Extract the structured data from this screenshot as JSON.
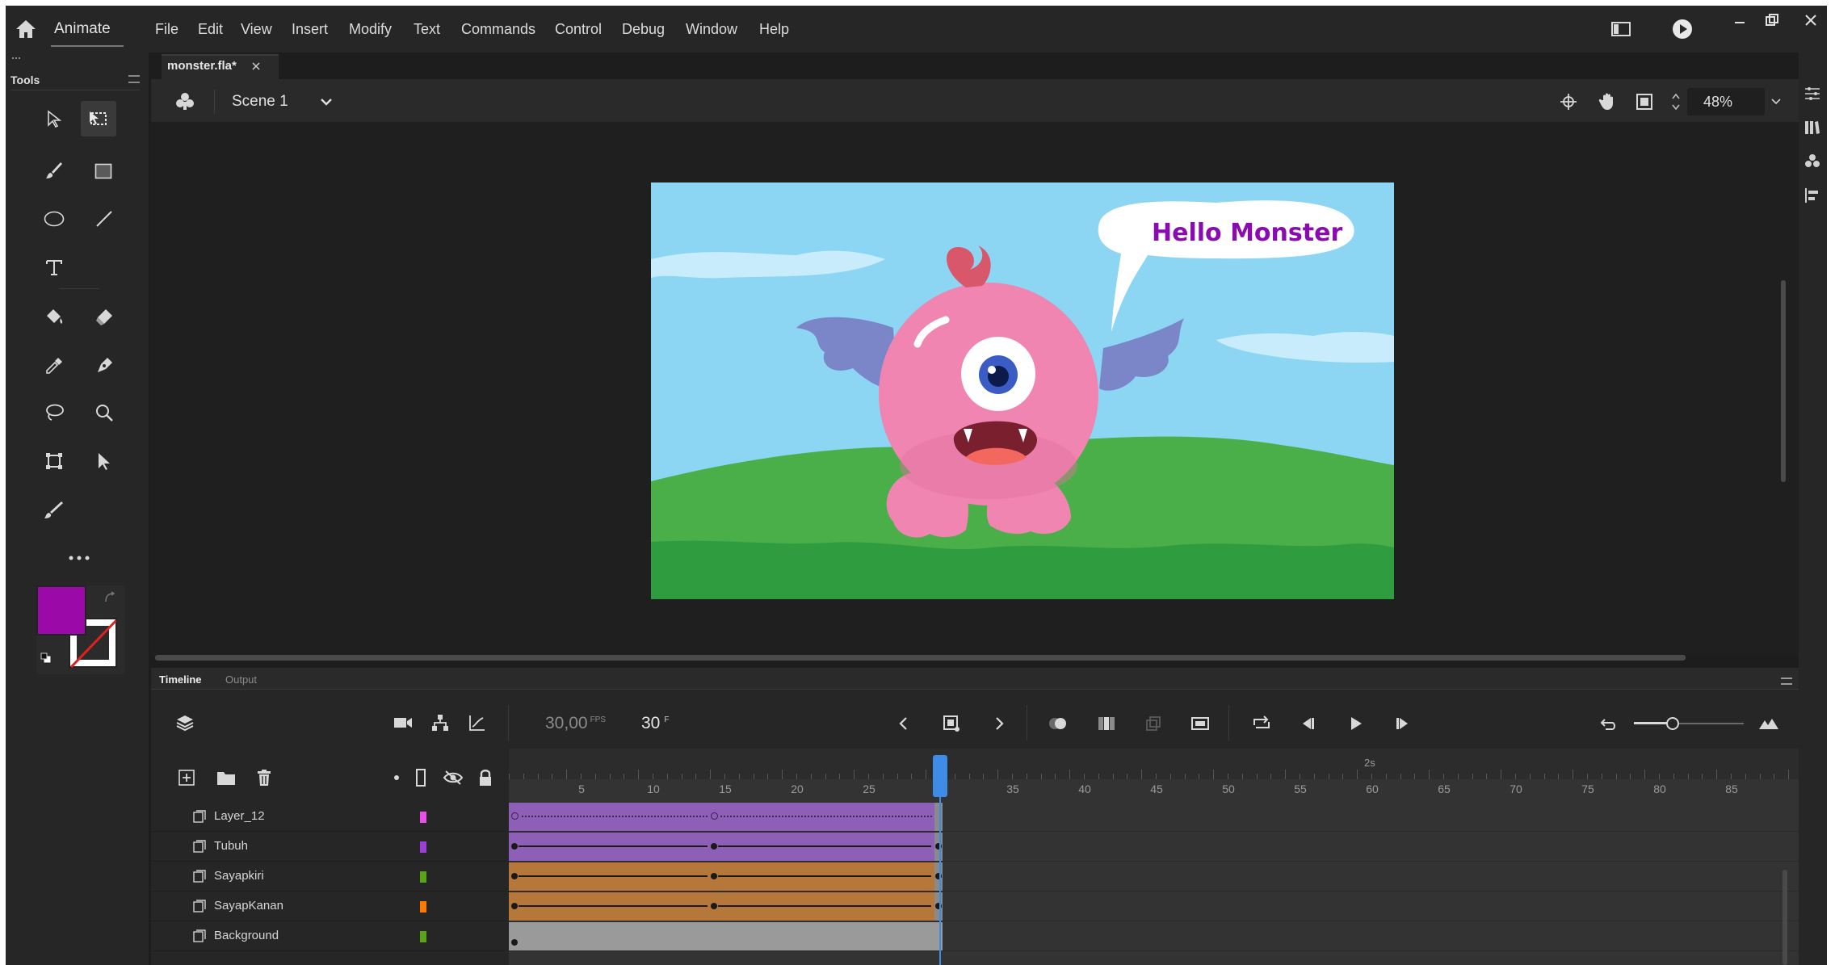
{
  "app": {
    "name": "Animate"
  },
  "menu": [
    "File",
    "Edit",
    "View",
    "Insert",
    "Modify",
    "Text",
    "Commands",
    "Control",
    "Debug",
    "Window",
    "Help"
  ],
  "tools_panel": {
    "title": "Tools"
  },
  "document": {
    "tab_label": "monster.fla*",
    "scene_label": "Scene 1",
    "zoom": "48%"
  },
  "stage": {
    "speech_text": "Hello Monster",
    "colors": {
      "sky": "#8cd6f3",
      "grass": "#4caf50",
      "monster": "#ef85b0",
      "wings": "#7b86c8",
      "speech_text": "#8a0cb0"
    }
  },
  "swatches": {
    "fill": "#9b0aa8",
    "stroke": "#ffffff"
  },
  "timeline": {
    "tabs": [
      "Timeline",
      "Output"
    ],
    "fps_value": "30,00",
    "fps_unit": "FPS",
    "current_frame": "30",
    "current_frame_unit": "F",
    "ruler_time_label": "2s",
    "ruler_numbers": [
      "5",
      "10",
      "15",
      "20",
      "25",
      "35",
      "40",
      "45",
      "50",
      "55",
      "60",
      "65",
      "70",
      "75",
      "80",
      "85"
    ],
    "layers": [
      {
        "name": "Layer_12",
        "color": "#e94fe9",
        "frames_color": "#8d5fb6"
      },
      {
        "name": "Tubuh",
        "color": "#9b3fd6",
        "frames_color": "#8d5fb6"
      },
      {
        "name": "Sayapkiri",
        "color": "#5aa517",
        "frames_color": "#b5773a"
      },
      {
        "name": "SayapKanan",
        "color": "#ff7a00",
        "frames_color": "#b5773a"
      },
      {
        "name": "Background",
        "color": "#5aa517",
        "frames_color": "#9a9a9a"
      }
    ]
  }
}
